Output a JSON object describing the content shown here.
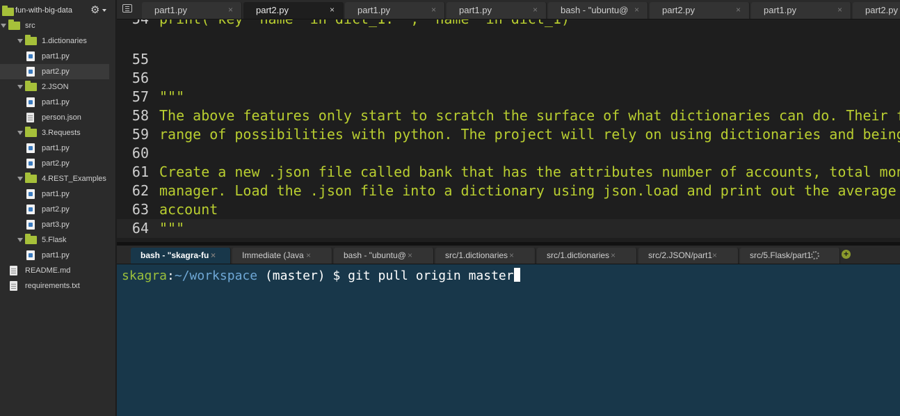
{
  "sidebar": {
    "project_name": "fun-with-big-data",
    "tree": [
      {
        "label": "src",
        "type": "folder",
        "depth": 0,
        "expanded": true
      },
      {
        "label": "1.dictionaries",
        "type": "folder",
        "depth": 1,
        "expanded": true
      },
      {
        "label": "part1.py",
        "type": "py",
        "depth": 2
      },
      {
        "label": "part2.py",
        "type": "py",
        "depth": 2,
        "selected": true
      },
      {
        "label": "2.JSON",
        "type": "folder",
        "depth": 1,
        "expanded": true
      },
      {
        "label": "part1.py",
        "type": "py",
        "depth": 2
      },
      {
        "label": "person.json",
        "type": "txt",
        "depth": 2
      },
      {
        "label": "3.Requests",
        "type": "folder",
        "depth": 1,
        "expanded": true
      },
      {
        "label": "part1.py",
        "type": "py",
        "depth": 2
      },
      {
        "label": "part2.py",
        "type": "py",
        "depth": 2
      },
      {
        "label": "4.REST_Examples",
        "type": "folder",
        "depth": 1,
        "expanded": true
      },
      {
        "label": "part1.py",
        "type": "py",
        "depth": 2
      },
      {
        "label": "part2.py",
        "type": "py",
        "depth": 2
      },
      {
        "label": "part3.py",
        "type": "py",
        "depth": 2
      },
      {
        "label": "5.Flask",
        "type": "folder",
        "depth": 1,
        "expanded": true
      },
      {
        "label": "part1.py",
        "type": "py",
        "depth": 2
      },
      {
        "label": "README.md",
        "type": "txt",
        "depth": 0
      },
      {
        "label": "requirements.txt",
        "type": "txt",
        "depth": 0
      }
    ]
  },
  "editor_tabs": [
    {
      "label": "part1.py",
      "active": false
    },
    {
      "label": "part2.py",
      "active": true
    },
    {
      "label": "part1.py",
      "active": false
    },
    {
      "label": "part1.py",
      "active": false
    },
    {
      "label": "bash - \"ubuntu@",
      "active": false
    },
    {
      "label": "part2.py",
      "active": false
    },
    {
      "label": "part1.py",
      "active": false
    },
    {
      "label": "part2.py",
      "active": false
    }
  ],
  "editor": {
    "partial_top_line": {
      "num": "54",
      "text": "print(\"key 'name' in dict_1: \", 'name' in dict_1)"
    },
    "lines": [
      {
        "num": "55",
        "text": ""
      },
      {
        "num": "56",
        "text": ""
      },
      {
        "num": "57",
        "text": "\"\"\""
      },
      {
        "num": "58",
        "text": "The above features only start to scratch the surface of what dictionaries can do. Their f"
      },
      {
        "num": "59",
        "text": "range of possibilities with python. The project will rely on using dictionaries and being"
      },
      {
        "num": "60",
        "text": ""
      },
      {
        "num": "61",
        "text": "Create a new .json file called bank that has the attributes number of accounts, total mon"
      },
      {
        "num": "62",
        "text": "manager. Load the .json file into a dictionary using json.load and print out the average "
      },
      {
        "num": "63",
        "text": "account"
      },
      {
        "num": "64",
        "text": "\"\"\"",
        "current": true
      }
    ]
  },
  "console_tabs": [
    {
      "label": "bash - \"skagra-fu",
      "active": true
    },
    {
      "label": "Immediate (Java",
      "active": false
    },
    {
      "label": "bash - \"ubuntu@",
      "active": false
    },
    {
      "label": "src/1.dictionaries",
      "active": false
    },
    {
      "label": "src/1.dictionaries",
      "active": false
    },
    {
      "label": "src/2.JSON/part1",
      "active": false
    },
    {
      "label": "src/5.Flask/part1",
      "active": false,
      "loading": true
    }
  ],
  "terminal": {
    "user": "skagra",
    "path": "~/workspace",
    "branch": "(master)",
    "prompt": "$",
    "command": "git pull origin master"
  },
  "colors": {
    "terminal_bg": "#18374a",
    "string_green": "#b9ce30",
    "folder_green": "#a6c03a"
  }
}
